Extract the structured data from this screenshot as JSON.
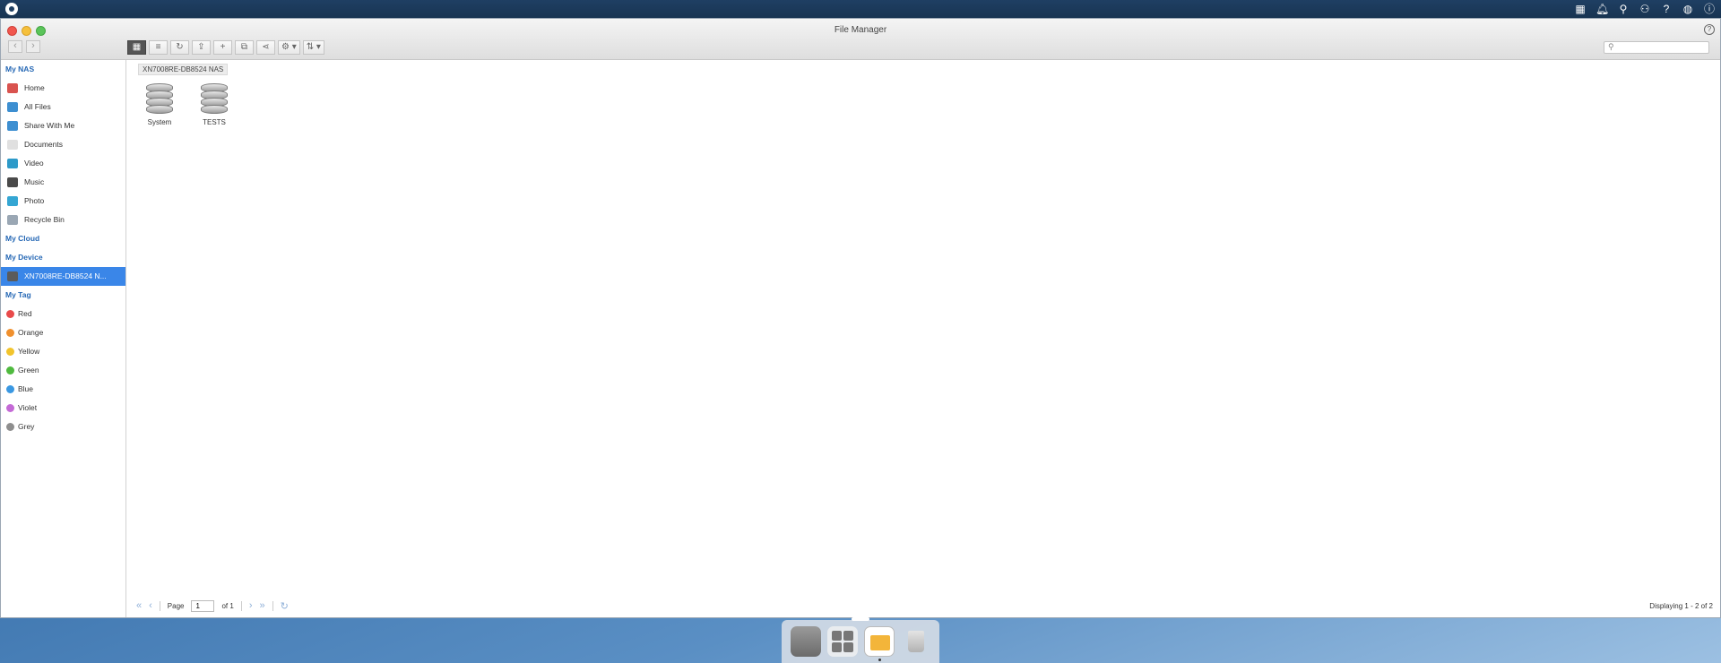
{
  "window": {
    "title": "File Manager"
  },
  "toolbar": {
    "buttons": [
      "grid-view",
      "list-view",
      "refresh",
      "upload",
      "new-folder",
      "transfer",
      "share",
      "settings",
      "sort"
    ]
  },
  "sidebar": {
    "sections": {
      "my_nas": "My NAS",
      "my_cloud": "My Cloud",
      "my_device": "My Device",
      "my_tag": "My Tag"
    },
    "nas_items": [
      {
        "label": "Home",
        "icon": "home-icon",
        "color": "#d9534f"
      },
      {
        "label": "All Files",
        "icon": "folder-icon",
        "color": "#3d8fd1"
      },
      {
        "label": "Share With Me",
        "icon": "shared-folder-icon",
        "color": "#3d8fd1"
      },
      {
        "label": "Documents",
        "icon": "document-icon",
        "color": "#e0e0e0"
      },
      {
        "label": "Video",
        "icon": "video-icon",
        "color": "#2d9ac9"
      },
      {
        "label": "Music",
        "icon": "music-icon",
        "color": "#4a4a4a"
      },
      {
        "label": "Photo",
        "icon": "photo-icon",
        "color": "#34a6d3"
      },
      {
        "label": "Recycle Bin",
        "icon": "recycle-bin-icon",
        "color": "#9aa7b4"
      }
    ],
    "device_item": "XN7008RE-DB8524 N...",
    "tags": [
      {
        "label": "Red",
        "color": "#e94b4b"
      },
      {
        "label": "Orange",
        "color": "#f0902e"
      },
      {
        "label": "Yellow",
        "color": "#f2c42c"
      },
      {
        "label": "Green",
        "color": "#4fba3f"
      },
      {
        "label": "Blue",
        "color": "#3a98e2"
      },
      {
        "label": "Violet",
        "color": "#c46ad6"
      },
      {
        "label": "Grey",
        "color": "#8e8e8e"
      }
    ]
  },
  "main": {
    "breadcrumb": "XN7008RE-DB8524 NAS",
    "files": [
      {
        "name": "System",
        "icon": "disk-volume-icon"
      },
      {
        "name": "TESTS",
        "icon": "disk-volume-icon"
      }
    ]
  },
  "pager": {
    "page_label": "Page",
    "page_value": "1",
    "of_label": "of 1",
    "displaying": "Displaying 1 - 2 of 2"
  },
  "colors": {
    "accent": "#3a86e8",
    "section_header": "#2668b5"
  }
}
